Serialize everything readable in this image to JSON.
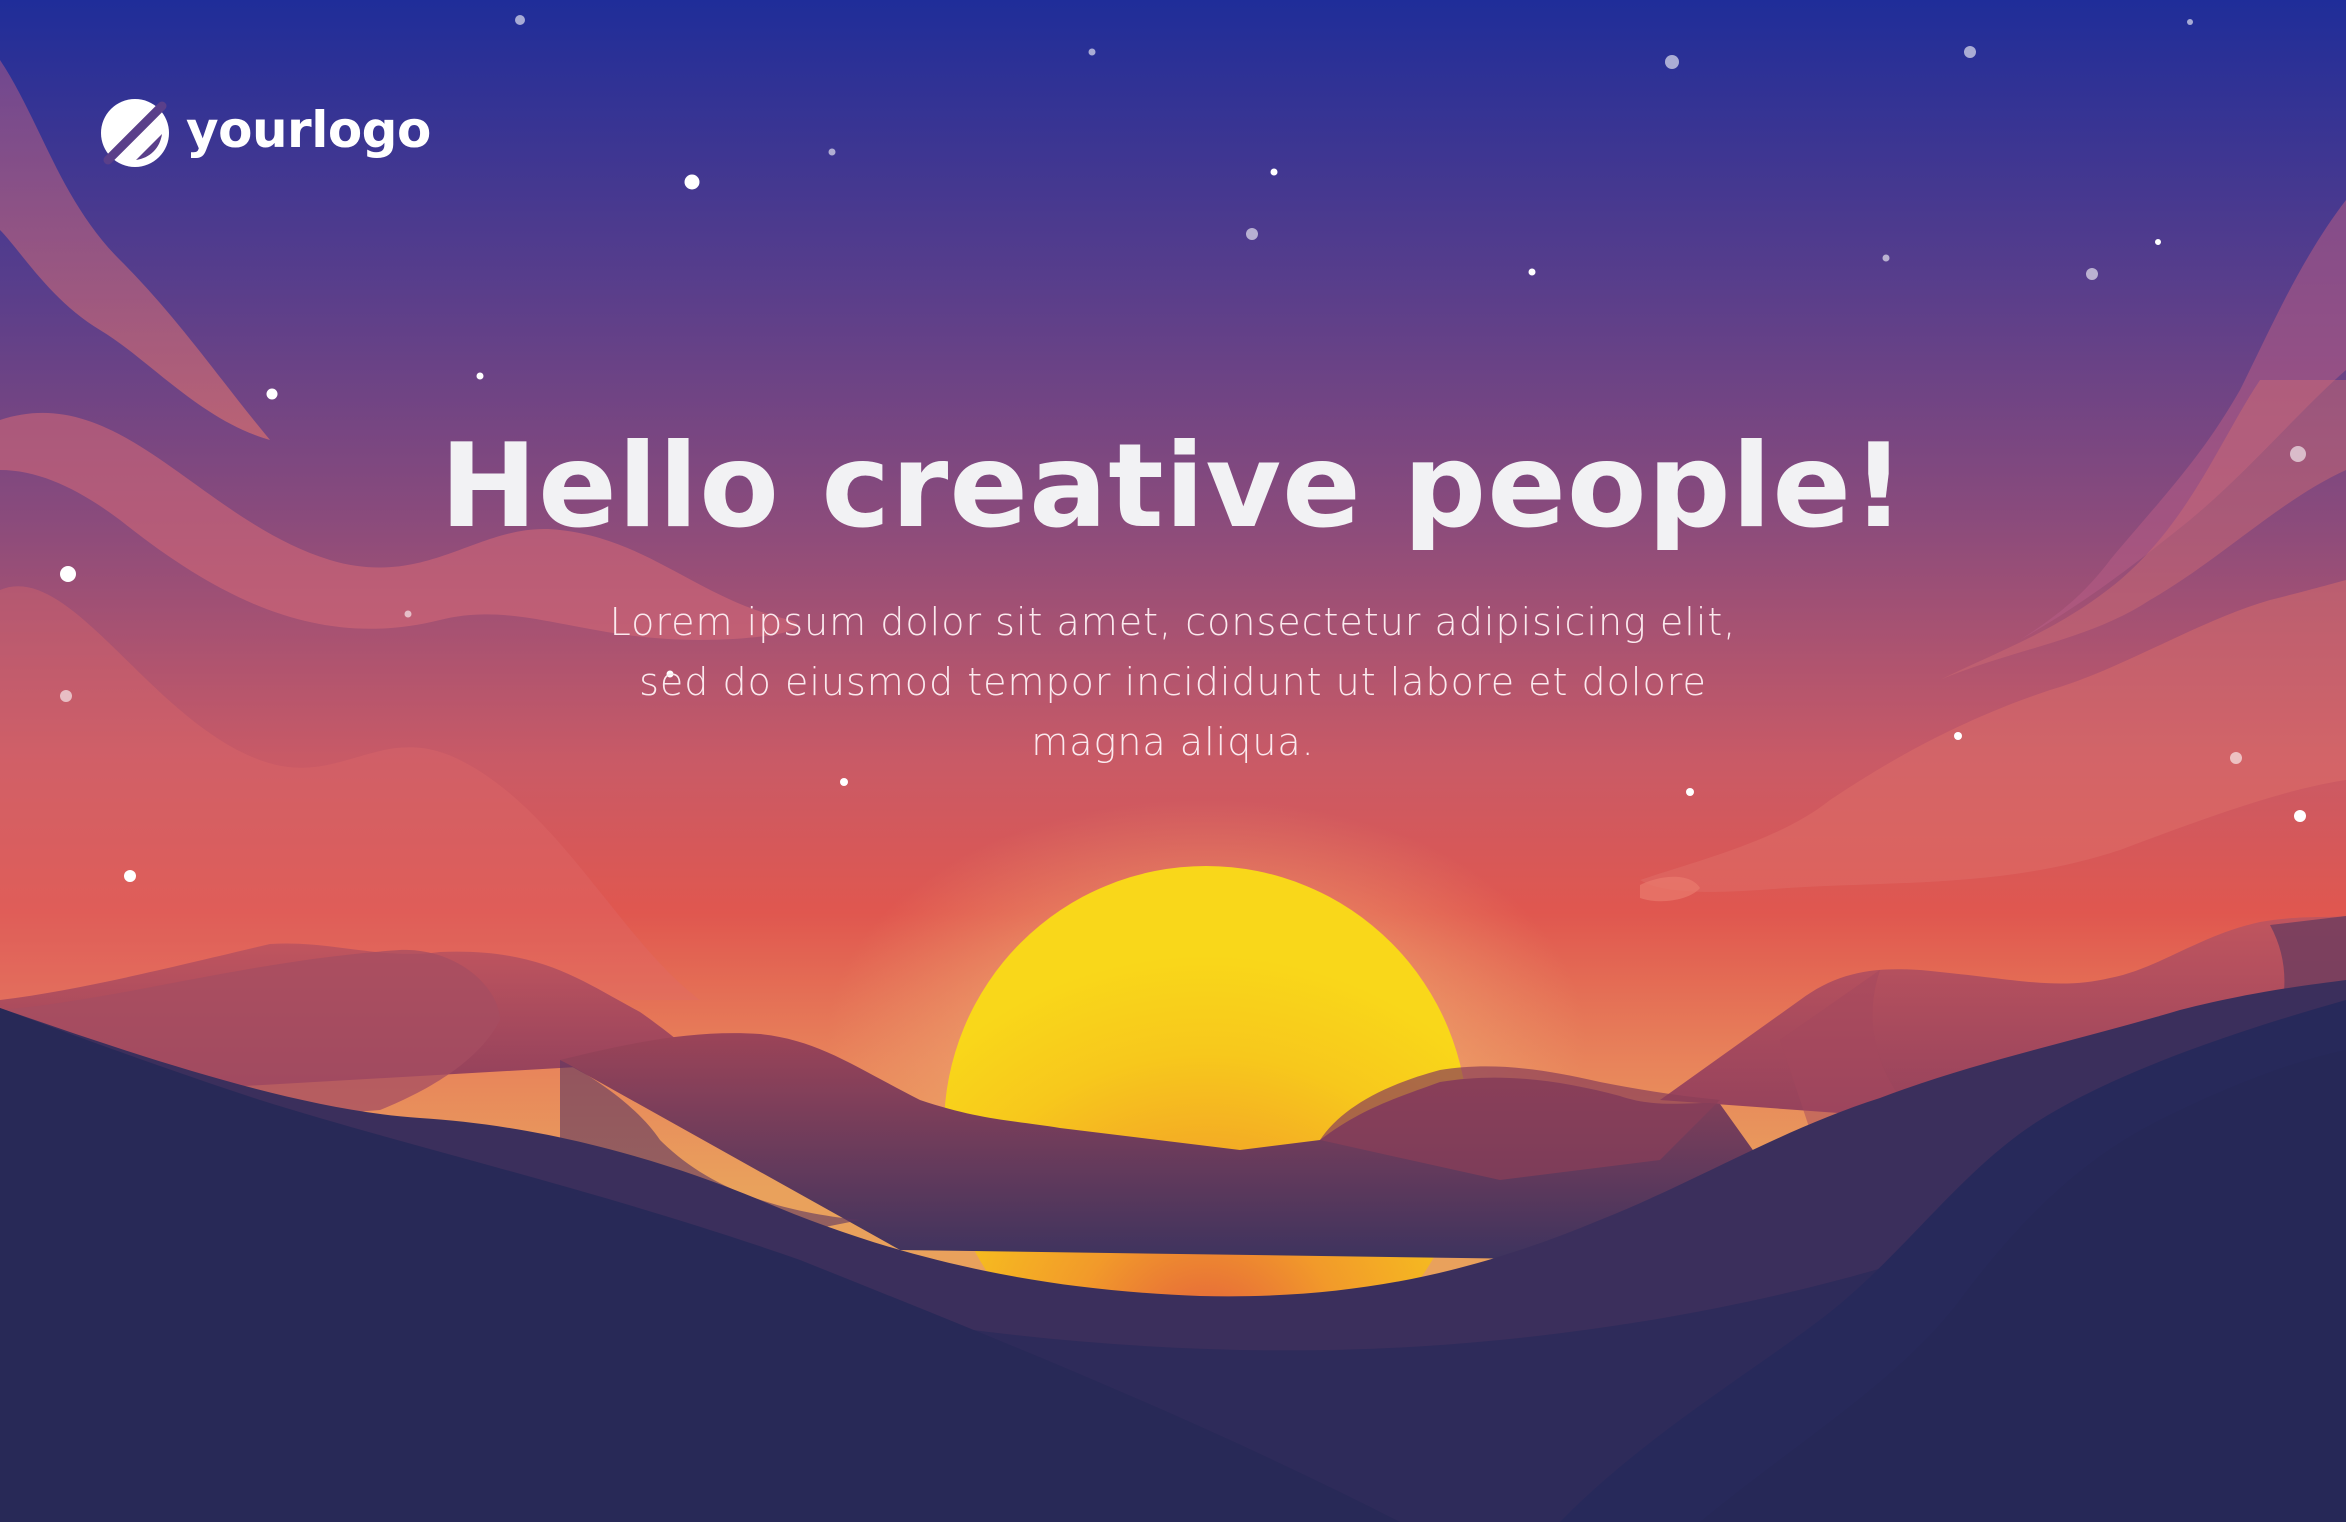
{
  "logo": {
    "text": "yourlogo",
    "icon": "leaf-slash-icon"
  },
  "hero": {
    "title": "Hello creative people!",
    "subtitle": "Lorem ipsum dolor sit amet, consectetur adipisicing elit, sed do eiusmod tempor incididunt ut labore et dolore magna aliqua."
  },
  "colors": {
    "sky_top": "#1f2d99",
    "sky_mid": "#8a4b7c",
    "sky_glow": "#e0574f",
    "horizon": "#e9a15c",
    "sun_center": "#f7d21c",
    "sun_edge": "#e4673f",
    "mountain_far": "#b4525f",
    "mountain_mid": "#7e3f62",
    "mountain_near": "#272a58",
    "text": "#f2f2f4"
  }
}
